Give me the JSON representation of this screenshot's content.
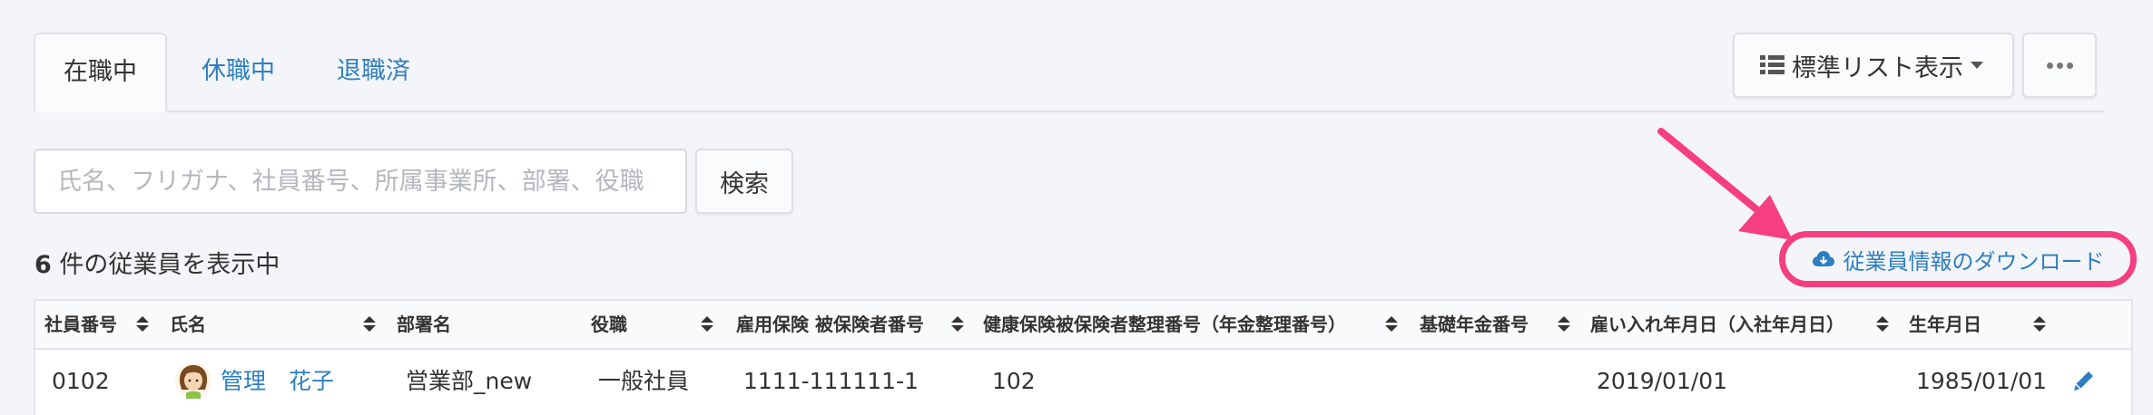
{
  "tabs": [
    {
      "label": "在職中",
      "active": true
    },
    {
      "label": "休職中",
      "active": false
    },
    {
      "label": "退職済",
      "active": false
    }
  ],
  "view_button": {
    "label": "標準リスト表示",
    "icon": "list-icon"
  },
  "more_button": {
    "icon": "more-icon"
  },
  "search": {
    "placeholder": "氏名、フリガナ、社員番号、所属事業所、部署、役職",
    "button_label": "検索"
  },
  "count": {
    "number": "6",
    "suffix": " 件の従業員を表示中"
  },
  "download": {
    "label": "従業員情報のダウンロード",
    "icon": "cloud-download-icon"
  },
  "colors": {
    "link": "#2e7fc1",
    "highlight": "#f53f80",
    "background": "#f4f5f9"
  },
  "table": {
    "headers": [
      "社員番号",
      "氏名",
      "部署名",
      "役職",
      "雇用保険 被保険者番号",
      "健康保険被保険者整理番号（年金整理番号）",
      "基礎年金番号",
      "雇い入れ年月日（入社年月日）",
      "生年月日"
    ],
    "rows": [
      {
        "employee_no": "0102",
        "name": "管理　花子",
        "department": "営業部_new",
        "position": "一般社員",
        "employment_insurance_no": "1111-111111-1",
        "health_insurance_no": "102",
        "basic_pension_no": "",
        "hire_date": "2019/01/01",
        "birth_date": "1985/01/01"
      }
    ]
  }
}
